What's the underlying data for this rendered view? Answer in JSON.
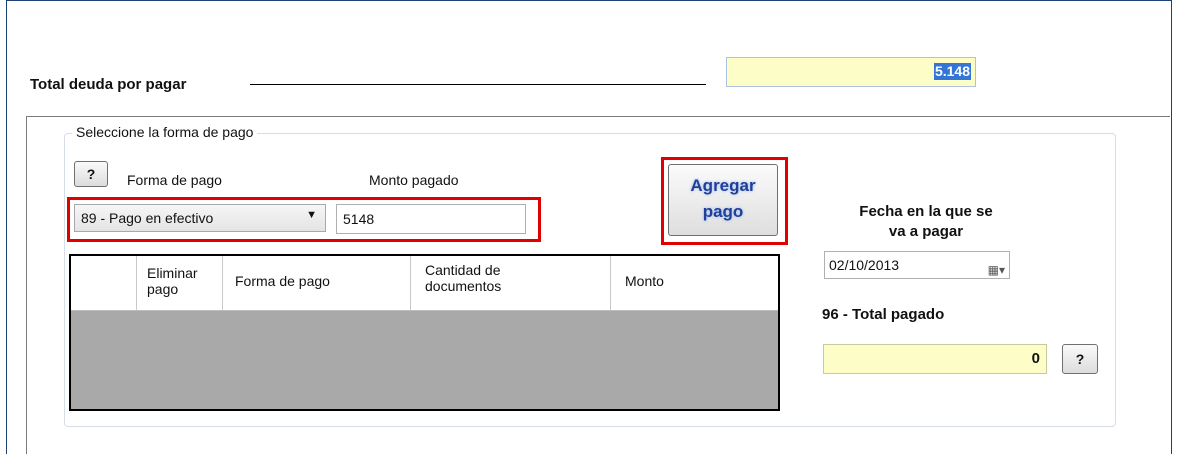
{
  "header": {
    "total_label": "Total deuda por pagar",
    "total_value": "5.148"
  },
  "payment": {
    "group_title": "Seleccione la forma de pago",
    "help_label": "?",
    "method_label": "Forma de pago",
    "amount_label": "Monto pagado",
    "method_selected": "89 - Pago en efectivo",
    "amount_value": "5148",
    "add_button_line1": "Agregar",
    "add_button_line2": "pago"
  },
  "table": {
    "columns": [
      {
        "line1": "Eliminar",
        "line2": "pago"
      },
      {
        "line1": "Forma de pago",
        "line2": ""
      },
      {
        "line1": "Cantidad de",
        "line2": "documentos"
      },
      {
        "line1": "Monto",
        "line2": ""
      }
    ],
    "rows": []
  },
  "side": {
    "date_label_line1": "Fecha en la que se",
    "date_label_line2": "va a pagar",
    "date_value": "02/10/2013",
    "total_paid_label": "96 - Total pagado",
    "total_paid_value": "0",
    "help_label": "?"
  },
  "colors": {
    "highlight_red": "#e00000",
    "readonly_yellow": "#fdfdc8",
    "selection_blue": "#3376d6",
    "button_text_blue": "#1f3f9a"
  },
  "icons": {
    "combo_arrow": "chevron-down-icon",
    "date_picker": "calendar-icon"
  }
}
